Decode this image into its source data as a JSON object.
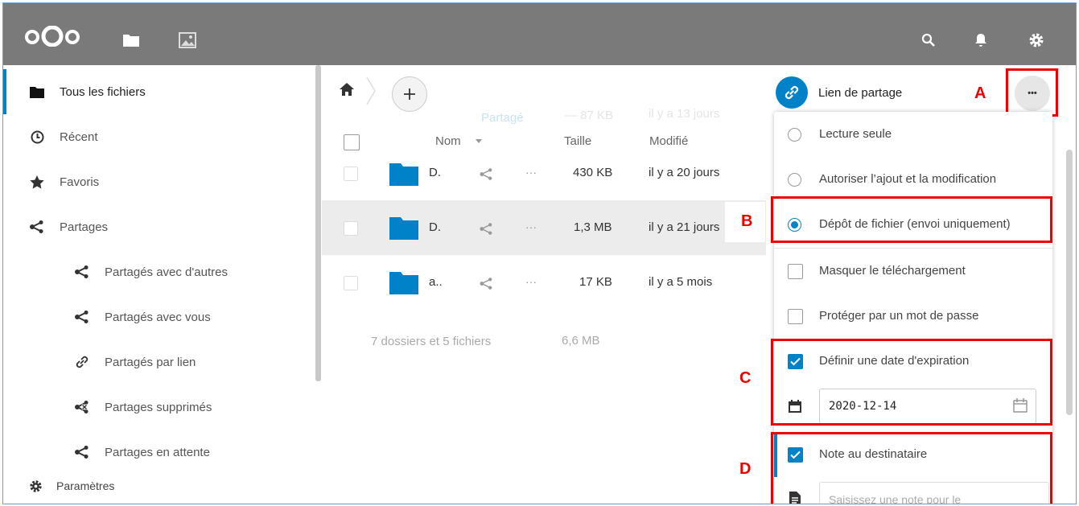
{
  "header": {
    "icons": [
      "nextcloud-logo",
      "files-icon",
      "photos-icon",
      "search-icon",
      "bell-icon",
      "gear-icon"
    ]
  },
  "sidebar": {
    "items": [
      {
        "label": "Tous les fichiers",
        "icon": "folder-icon",
        "active": true
      },
      {
        "label": "Récent",
        "icon": "clock-icon"
      },
      {
        "label": "Favoris",
        "icon": "star-icon"
      },
      {
        "label": "Partages",
        "icon": "share-icon"
      },
      {
        "label": "Partagés avec d'autres",
        "icon": "share-icon"
      },
      {
        "label": "Partagés avec vous",
        "icon": "share-icon"
      },
      {
        "label": "Partagés par lien",
        "icon": "link-icon"
      },
      {
        "label": "Partages supprimés",
        "icon": "share-deleted-icon"
      },
      {
        "label": "Partages en attente",
        "icon": "share-icon"
      }
    ],
    "settings_label": "Paramètres"
  },
  "files": {
    "columns": {
      "name": "Nom",
      "size": "Taille",
      "modified": "Modifié"
    },
    "ghost_row": {
      "share": "Partagé",
      "size": "— 87 KB",
      "modified": "il y a 13 jours"
    },
    "rows": [
      {
        "name": "D.",
        "size": "430 KB",
        "modified": "il y a 20 jours",
        "more": "···"
      },
      {
        "name": "D.",
        "size": "1,3 MB",
        "modified": "il y a 21 jours",
        "more": "···"
      },
      {
        "name": "a..",
        "size": "17 KB",
        "modified": "il y a 5 mois",
        "more": "···"
      }
    ],
    "summary": {
      "count": "7 dossiers et 5 fichiers",
      "size": "6,6 MB"
    },
    "folder_color": "#0082c9"
  },
  "panel": {
    "link_label": "Lien de partage",
    "more_label": "•••",
    "menu": [
      {
        "type": "radio",
        "label": "Lecture seule",
        "checked": false
      },
      {
        "type": "radio",
        "label": "Autoriser l’ajout et la modification",
        "checked": false
      },
      {
        "type": "radio",
        "label": "Dépôt de fichier (envoi uniquement)",
        "checked": true
      },
      {
        "type": "checkbox",
        "label": "Masquer le téléchargement",
        "checked": false
      },
      {
        "type": "checkbox",
        "label": "Protéger par un mot de passe",
        "checked": false
      },
      {
        "type": "checkbox",
        "label": "Définir une date d'expiration",
        "checked": true
      },
      {
        "type": "checkbox",
        "label": "Note au destinataire",
        "checked": true
      }
    ],
    "expiration_date": "2020-12-14",
    "note_placeholder": "Saisissez une note pour le"
  },
  "annotations": {
    "a": "A",
    "b": "B",
    "c": "C",
    "d": "D"
  },
  "colors": {
    "accent": "#0082c9",
    "header": "#7a7a7a",
    "annotation": "#e00000"
  }
}
